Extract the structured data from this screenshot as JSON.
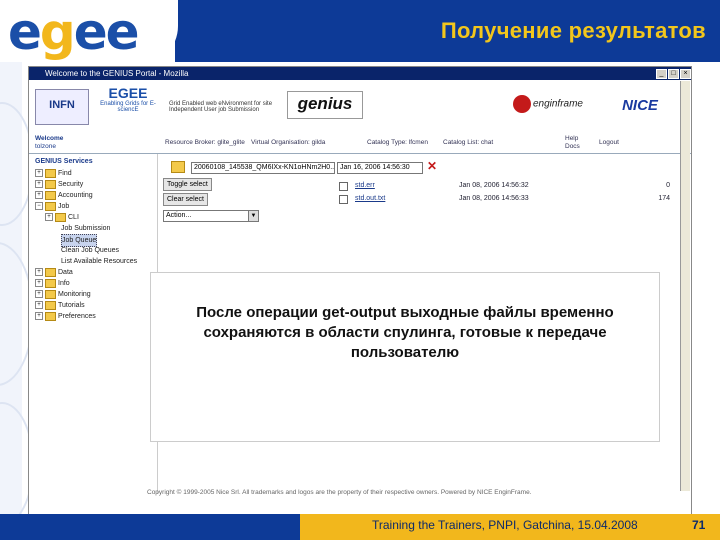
{
  "slide": {
    "title": "Получение результатов",
    "logo_text_e1": "e",
    "logo_text_g": "g",
    "logo_text_e2": "ee",
    "overlay_text": "После операции get-output выходные файлы временно сохраняются в области спулинга, готовые к передаче пользователю",
    "footer_text": "Training the Trainers, PNPI, Gatchina, 15.04.2008",
    "page_number": "71",
    "colors": {
      "brand_blue": "#0d3a97",
      "brand_yellow": "#f2b71c"
    }
  },
  "browser": {
    "window_title": "Welcome to the GENIUS Portal - Mozilla",
    "logos": [
      "INFN",
      "EGEE",
      "Grid Enabled web eNvironment for site Independent User job Submission",
      "genius",
      "enginframe",
      "NICE"
    ],
    "egee_tagline": "Enabling Grids for E-sciencE",
    "status": {
      "welcome": "Welcome",
      "user": "tolzone",
      "broker": "Resource Broker: glite_glite",
      "vo": "Virtual Organisation: gilda",
      "catalog_type": "Catalog Type: lfcmen",
      "catalog_list": "Catalog List: chat",
      "help": "Help",
      "docs": "Docs",
      "logout": "Logout"
    },
    "sidebar": {
      "header": "GENIUS Services",
      "items": [
        "Find",
        "Security",
        "Accounting",
        "Job",
        "CLI",
        "Job Submission",
        "Job Queue",
        "Clean Job Queues",
        "List Available Resources",
        "Data",
        "Info",
        "Monitoring",
        "Tutorials",
        "Preferences"
      ]
    },
    "main": {
      "path_value": "20060108_145538_QM6IXx-KN1oHNm2H0...",
      "date_value": "Jan 16, 2006 14:56:30",
      "toggle_select": "Toggle select",
      "clear_select": "Clear select",
      "action_placeholder": "Action...",
      "files": [
        {
          "name": "std.err",
          "date": "Jan 08, 2006 14:56:32",
          "size": "0"
        },
        {
          "name": "std.out.txt",
          "date": "Jan 08, 2006 14:56:33",
          "size": "174"
        }
      ]
    },
    "copyright": "Copyright © 1999-2005 Nice Srl. All trademarks and logos are the property of their respective owners. Powered by NICE EnginFrame."
  }
}
